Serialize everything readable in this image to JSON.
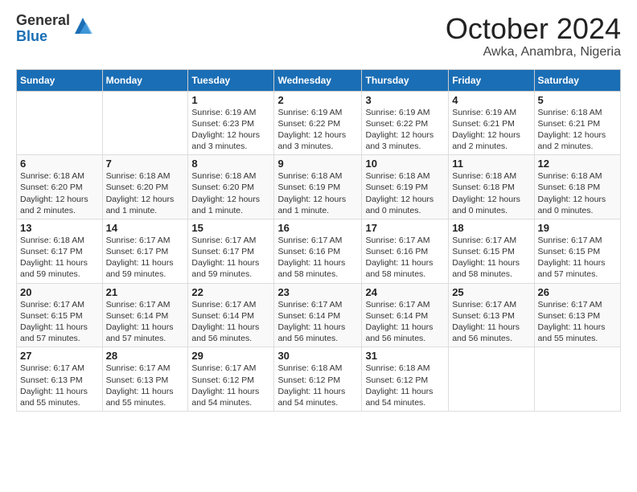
{
  "header": {
    "logo_general": "General",
    "logo_blue": "Blue",
    "month": "October 2024",
    "location": "Awka, Anambra, Nigeria"
  },
  "weekdays": [
    "Sunday",
    "Monday",
    "Tuesday",
    "Wednesday",
    "Thursday",
    "Friday",
    "Saturday"
  ],
  "weeks": [
    [
      {
        "day": "",
        "info": ""
      },
      {
        "day": "",
        "info": ""
      },
      {
        "day": "1",
        "info": "Sunrise: 6:19 AM\nSunset: 6:23 PM\nDaylight: 12 hours and 3 minutes."
      },
      {
        "day": "2",
        "info": "Sunrise: 6:19 AM\nSunset: 6:22 PM\nDaylight: 12 hours and 3 minutes."
      },
      {
        "day": "3",
        "info": "Sunrise: 6:19 AM\nSunset: 6:22 PM\nDaylight: 12 hours and 3 minutes."
      },
      {
        "day": "4",
        "info": "Sunrise: 6:19 AM\nSunset: 6:21 PM\nDaylight: 12 hours and 2 minutes."
      },
      {
        "day": "5",
        "info": "Sunrise: 6:18 AM\nSunset: 6:21 PM\nDaylight: 12 hours and 2 minutes."
      }
    ],
    [
      {
        "day": "6",
        "info": "Sunrise: 6:18 AM\nSunset: 6:20 PM\nDaylight: 12 hours and 2 minutes."
      },
      {
        "day": "7",
        "info": "Sunrise: 6:18 AM\nSunset: 6:20 PM\nDaylight: 12 hours and 1 minute."
      },
      {
        "day": "8",
        "info": "Sunrise: 6:18 AM\nSunset: 6:20 PM\nDaylight: 12 hours and 1 minute."
      },
      {
        "day": "9",
        "info": "Sunrise: 6:18 AM\nSunset: 6:19 PM\nDaylight: 12 hours and 1 minute."
      },
      {
        "day": "10",
        "info": "Sunrise: 6:18 AM\nSunset: 6:19 PM\nDaylight: 12 hours and 0 minutes."
      },
      {
        "day": "11",
        "info": "Sunrise: 6:18 AM\nSunset: 6:18 PM\nDaylight: 12 hours and 0 minutes."
      },
      {
        "day": "12",
        "info": "Sunrise: 6:18 AM\nSunset: 6:18 PM\nDaylight: 12 hours and 0 minutes."
      }
    ],
    [
      {
        "day": "13",
        "info": "Sunrise: 6:18 AM\nSunset: 6:17 PM\nDaylight: 11 hours and 59 minutes."
      },
      {
        "day": "14",
        "info": "Sunrise: 6:17 AM\nSunset: 6:17 PM\nDaylight: 11 hours and 59 minutes."
      },
      {
        "day": "15",
        "info": "Sunrise: 6:17 AM\nSunset: 6:17 PM\nDaylight: 11 hours and 59 minutes."
      },
      {
        "day": "16",
        "info": "Sunrise: 6:17 AM\nSunset: 6:16 PM\nDaylight: 11 hours and 58 minutes."
      },
      {
        "day": "17",
        "info": "Sunrise: 6:17 AM\nSunset: 6:16 PM\nDaylight: 11 hours and 58 minutes."
      },
      {
        "day": "18",
        "info": "Sunrise: 6:17 AM\nSunset: 6:15 PM\nDaylight: 11 hours and 58 minutes."
      },
      {
        "day": "19",
        "info": "Sunrise: 6:17 AM\nSunset: 6:15 PM\nDaylight: 11 hours and 57 minutes."
      }
    ],
    [
      {
        "day": "20",
        "info": "Sunrise: 6:17 AM\nSunset: 6:15 PM\nDaylight: 11 hours and 57 minutes."
      },
      {
        "day": "21",
        "info": "Sunrise: 6:17 AM\nSunset: 6:14 PM\nDaylight: 11 hours and 57 minutes."
      },
      {
        "day": "22",
        "info": "Sunrise: 6:17 AM\nSunset: 6:14 PM\nDaylight: 11 hours and 56 minutes."
      },
      {
        "day": "23",
        "info": "Sunrise: 6:17 AM\nSunset: 6:14 PM\nDaylight: 11 hours and 56 minutes."
      },
      {
        "day": "24",
        "info": "Sunrise: 6:17 AM\nSunset: 6:14 PM\nDaylight: 11 hours and 56 minutes."
      },
      {
        "day": "25",
        "info": "Sunrise: 6:17 AM\nSunset: 6:13 PM\nDaylight: 11 hours and 56 minutes."
      },
      {
        "day": "26",
        "info": "Sunrise: 6:17 AM\nSunset: 6:13 PM\nDaylight: 11 hours and 55 minutes."
      }
    ],
    [
      {
        "day": "27",
        "info": "Sunrise: 6:17 AM\nSunset: 6:13 PM\nDaylight: 11 hours and 55 minutes."
      },
      {
        "day": "28",
        "info": "Sunrise: 6:17 AM\nSunset: 6:13 PM\nDaylight: 11 hours and 55 minutes."
      },
      {
        "day": "29",
        "info": "Sunrise: 6:17 AM\nSunset: 6:12 PM\nDaylight: 11 hours and 54 minutes."
      },
      {
        "day": "30",
        "info": "Sunrise: 6:18 AM\nSunset: 6:12 PM\nDaylight: 11 hours and 54 minutes."
      },
      {
        "day": "31",
        "info": "Sunrise: 6:18 AM\nSunset: 6:12 PM\nDaylight: 11 hours and 54 minutes."
      },
      {
        "day": "",
        "info": ""
      },
      {
        "day": "",
        "info": ""
      }
    ]
  ]
}
